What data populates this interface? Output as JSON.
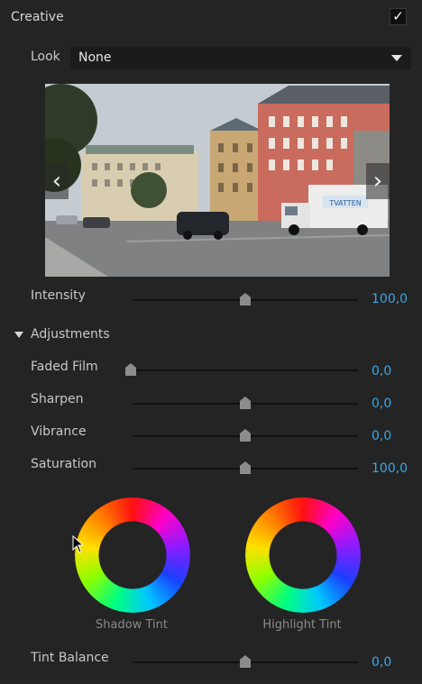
{
  "section": {
    "title": "Creative",
    "checked": "✓"
  },
  "look": {
    "label": "Look",
    "value": "None"
  },
  "preview": {
    "prev_glyph": "‹",
    "next_glyph": "›",
    "truck_text": "TVATTEN"
  },
  "intensity": {
    "label": "Intensity",
    "value": "100,0",
    "level": 0.5
  },
  "adjustments": {
    "title": "Adjustments",
    "sliders": [
      {
        "label": "Faded Film",
        "value": "0,0",
        "level": 0.0
      },
      {
        "label": "Sharpen",
        "value": "0,0",
        "level": 0.5
      },
      {
        "label": "Vibrance",
        "value": "0,0",
        "level": 0.5
      },
      {
        "label": "Saturation",
        "value": "100,0",
        "level": 0.5
      }
    ]
  },
  "tints": {
    "shadow_label": "Shadow Tint",
    "highlight_label": "Highlight Tint"
  },
  "tint_balance": {
    "label": "Tint Balance",
    "value": "0,0",
    "level": 0.5
  },
  "colors": {
    "accent": "#3aa6e8",
    "panel": "#242424"
  }
}
